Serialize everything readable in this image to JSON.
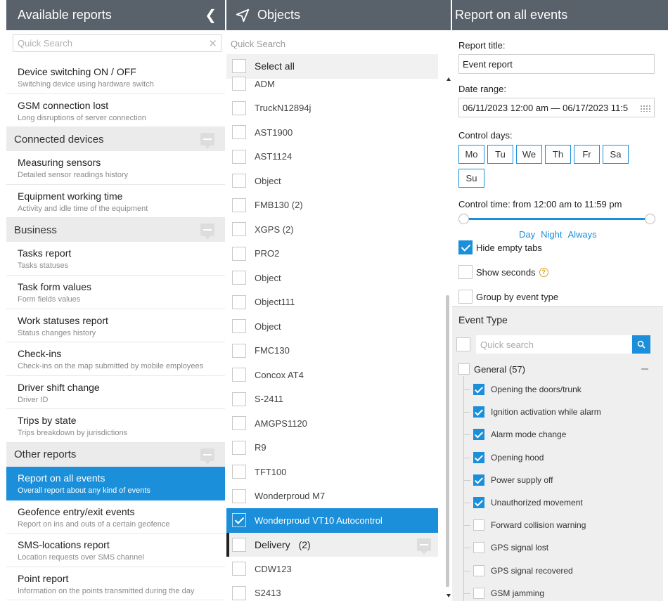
{
  "reports_panel": {
    "title": "Available reports",
    "search_placeholder": "Quick Search",
    "items_top": [
      {
        "title": "Device switching ON / OFF",
        "subtitle": "Switching device using hardware switch"
      },
      {
        "title": "GSM connection lost",
        "subtitle": "Long disruptions of server connection"
      }
    ],
    "groups": [
      {
        "name": "Connected devices",
        "items": [
          {
            "title": "Measuring sensors",
            "subtitle": "Detailed sensor readings history"
          },
          {
            "title": "Equipment working time",
            "subtitle": "Activity and idle time of the equipment"
          }
        ]
      },
      {
        "name": "Business",
        "items": [
          {
            "title": "Tasks report",
            "subtitle": "Tasks statuses"
          },
          {
            "title": "Task form values",
            "subtitle": "Form fields values"
          },
          {
            "title": "Work statuses report",
            "subtitle": "Status changes history"
          },
          {
            "title": "Check-ins",
            "subtitle": "Check-ins on the map submitted by mobile employees"
          },
          {
            "title": "Driver shift change",
            "subtitle": "Driver ID"
          },
          {
            "title": "Trips by state",
            "subtitle": "Trips breakdown by jurisdictions"
          }
        ]
      },
      {
        "name": "Other reports",
        "items": [
          {
            "title": "Report on all events",
            "subtitle": "Overall report about any kind of events",
            "active": true
          },
          {
            "title": "Geofence entry/exit events",
            "subtitle": "Report on ins and outs of a certain geofence"
          },
          {
            "title": "SMS-locations report",
            "subtitle": "Location requests over SMS channel"
          },
          {
            "title": "Point report",
            "subtitle": "Information on the points transmitted during the day"
          }
        ]
      }
    ]
  },
  "objects_panel": {
    "title": "Objects",
    "search_placeholder": "Quick Search",
    "select_all_label": "Select all",
    "objects": [
      {
        "name": "ADM",
        "checked": false
      },
      {
        "name": "TruckN12894j",
        "checked": false
      },
      {
        "name": "AST1900",
        "checked": false
      },
      {
        "name": "AST1124",
        "checked": false
      },
      {
        "name": "Object",
        "checked": false
      },
      {
        "name": "FMB130 (2)",
        "checked": false
      },
      {
        "name": "XGPS (2)",
        "checked": false
      },
      {
        "name": "PRO2",
        "checked": false
      },
      {
        "name": "Object",
        "checked": false
      },
      {
        "name": "Object111",
        "checked": false
      },
      {
        "name": "Object",
        "checked": false
      },
      {
        "name": "FMC130",
        "checked": false
      },
      {
        "name": "Concox AT4",
        "checked": false
      },
      {
        "name": "S-2411",
        "checked": false
      },
      {
        "name": "AMGPS1120",
        "checked": false
      },
      {
        "name": "R9",
        "checked": false
      },
      {
        "name": "TFT100",
        "checked": false
      },
      {
        "name": "Wonderproud M7",
        "checked": false
      },
      {
        "name": "Wonderproud VT10 Autocontrol",
        "checked": true
      }
    ],
    "delivery_group": {
      "name": "Delivery",
      "count": "(2)"
    },
    "delivery_objects": [
      {
        "name": "CDW123",
        "checked": false
      },
      {
        "name": "S2413",
        "checked": false
      }
    ]
  },
  "report_panel": {
    "title": "Report on all events",
    "report_title_label": "Report title:",
    "report_title_value": "Event report",
    "date_range_label": "Date range:",
    "date_range_value": "06/11/2023 12:00 am — 06/17/2023 11:5",
    "control_days_label": "Control days:",
    "days": [
      "Mo",
      "Tu",
      "We",
      "Th",
      "Fr",
      "Sa",
      "Su"
    ],
    "control_time_label": "Control time: from 12:00 am to 11:59 pm",
    "time_modes": [
      "Day",
      "Night",
      "Always"
    ],
    "hide_empty_tabs": {
      "label": "Hide empty tabs",
      "checked": true
    },
    "show_seconds": {
      "label": "Show seconds",
      "checked": false
    },
    "group_by_event": {
      "label": "Group by event type",
      "checked": false
    },
    "accent_color": "#1b8fd9"
  },
  "event_type": {
    "title": "Event Type",
    "search_placeholder": "Quick search",
    "group_label": "General (57)",
    "events": [
      {
        "name": "Opening the doors/trunk",
        "checked": true
      },
      {
        "name": "Ignition activation while alarm",
        "checked": true
      },
      {
        "name": "Alarm mode change",
        "checked": true
      },
      {
        "name": "Opening hood",
        "checked": true
      },
      {
        "name": "Power supply off",
        "checked": true
      },
      {
        "name": "Unauthorized movement",
        "checked": true
      },
      {
        "name": "Forward collision warning",
        "checked": false
      },
      {
        "name": "GPS signal lost",
        "checked": false
      },
      {
        "name": "GPS signal recovered",
        "checked": false
      },
      {
        "name": "GSM jamming",
        "checked": false
      }
    ]
  }
}
